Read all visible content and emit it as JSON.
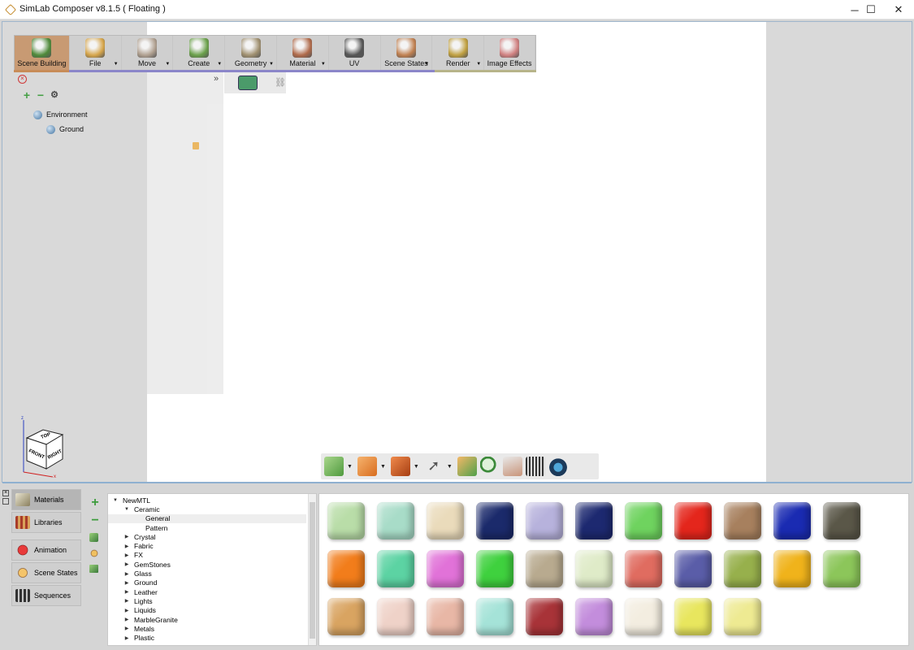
{
  "window": {
    "title": "SimLab Composer v8.1.5 ( Floating )",
    "minimize": "─",
    "maximize": "☐",
    "close": "✕"
  },
  "toolbar": {
    "items": [
      {
        "label": "Scene Building",
        "icon": "scene-building-icon",
        "dropdown": false,
        "active": true
      },
      {
        "label": "File",
        "icon": "file-icon",
        "dropdown": true
      },
      {
        "label": "Move",
        "icon": "move-icon",
        "dropdown": true
      },
      {
        "label": "Create",
        "icon": "create-icon",
        "dropdown": true
      },
      {
        "label": "Geometry",
        "icon": "geometry-icon",
        "dropdown": true
      },
      {
        "label": "Material",
        "icon": "material-icon",
        "dropdown": true
      },
      {
        "label": "UV",
        "icon": "uv-icon",
        "dropdown": false
      },
      {
        "label": "Scene States",
        "icon": "scene-states-icon",
        "dropdown": true
      },
      {
        "label": "Render",
        "icon": "render-icon",
        "dropdown": true
      },
      {
        "label": "Image Effects",
        "icon": "image-effects-icon",
        "dropdown": false
      }
    ]
  },
  "scene_tree": {
    "items": [
      {
        "label": "Environment",
        "level": 0
      },
      {
        "label": "Ground",
        "level": 1
      }
    ]
  },
  "navcube": {
    "top": "TOP",
    "front": "FRONT",
    "right": "RIGHT",
    "axis_z": "z",
    "axis_x": "x"
  },
  "bottom_tabs": [
    {
      "label": "Materials",
      "active": true
    },
    {
      "label": "Libraries"
    },
    {
      "label": "Animation"
    },
    {
      "label": "Scene States"
    },
    {
      "label": "Sequences"
    }
  ],
  "material_tree": [
    {
      "label": "NewMTL",
      "indent": 0,
      "arrow": "▼"
    },
    {
      "label": "Ceramic",
      "indent": 1,
      "arrow": "▼"
    },
    {
      "label": "General",
      "indent": 2,
      "arrow": "",
      "selected": true
    },
    {
      "label": "Pattern",
      "indent": 2,
      "arrow": ""
    },
    {
      "label": "Crystal",
      "indent": 1,
      "arrow": "▶"
    },
    {
      "label": "Fabric",
      "indent": 1,
      "arrow": "▶"
    },
    {
      "label": "FX",
      "indent": 1,
      "arrow": "▶"
    },
    {
      "label": "GemStones",
      "indent": 1,
      "arrow": "▶"
    },
    {
      "label": "Glass",
      "indent": 1,
      "arrow": "▶"
    },
    {
      "label": "Ground",
      "indent": 1,
      "arrow": "▶"
    },
    {
      "label": "Leather",
      "indent": 1,
      "arrow": "▶"
    },
    {
      "label": "Lights",
      "indent": 1,
      "arrow": "▶"
    },
    {
      "label": "Liquids",
      "indent": 1,
      "arrow": "▶"
    },
    {
      "label": "MarbleGranite",
      "indent": 1,
      "arrow": "▶"
    },
    {
      "label": "Metals",
      "indent": 1,
      "arrow": "▶"
    },
    {
      "label": "Plastic",
      "indent": 1,
      "arrow": "▶"
    }
  ],
  "material_swatches": [
    [
      "#b9dda8",
      "#a8dcc8",
      "#eadbbb",
      "#1b2a6b",
      "#b7b2dc",
      "#1d2970",
      "#6fd35f",
      "#e4261c",
      "#a7805e",
      "#1a2bb2",
      "#5a5748"
    ],
    [
      "#f27d1b",
      "#5cd3a3",
      "#e172d8",
      "#3fd13e",
      "#b8aa8f",
      "#dfebc8",
      "#e06c60",
      "#5a5da8",
      "#97b04c",
      "#f0b31b",
      "#8cc65a"
    ],
    [
      "#d9a461",
      "#efd2c8",
      "#e8b7a6",
      "#a5e3d8",
      "#a83338",
      "#c38ddc",
      "#f3ede0",
      "#e8e65e",
      "#eeea92"
    ]
  ],
  "colors": {
    "accent_active": "#c89a73",
    "viewport_border": "#9fb6cc"
  }
}
